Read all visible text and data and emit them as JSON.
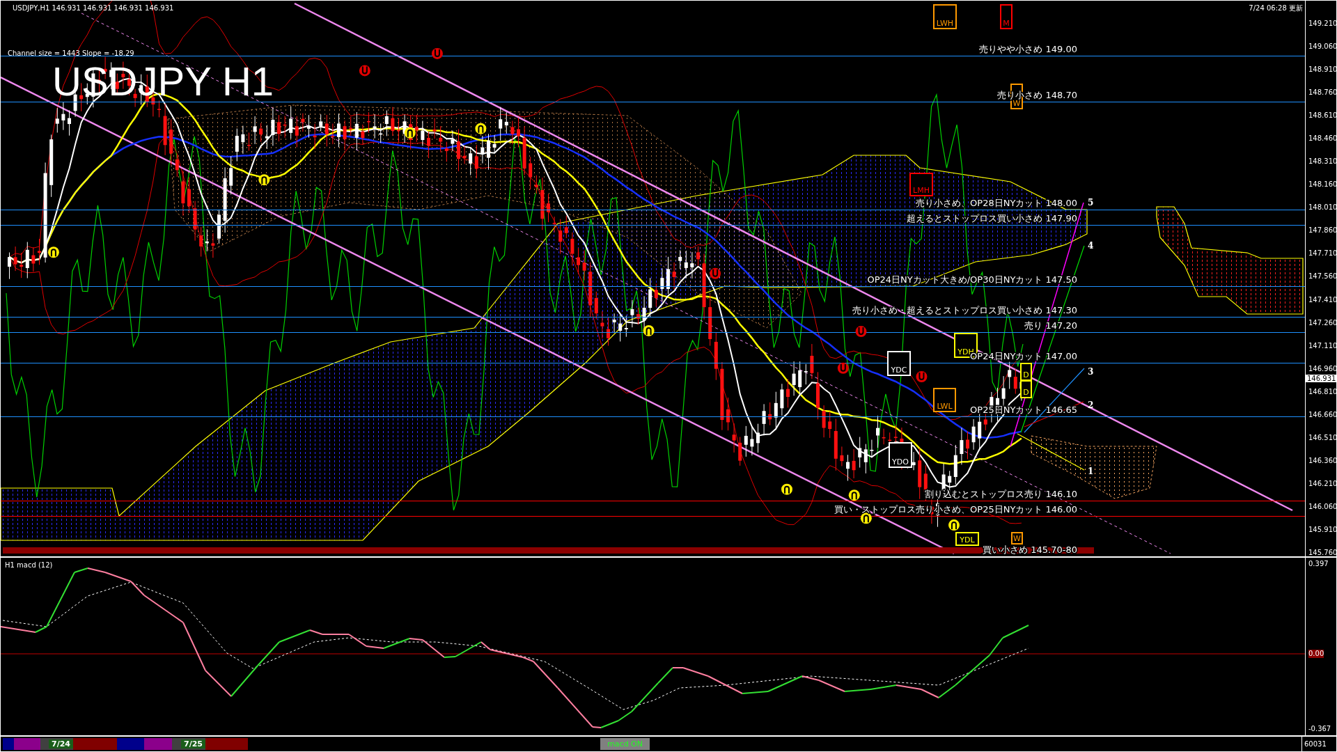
{
  "chart": {
    "header": "USDJPY,H1  146.931 146.931 146.931 146.931",
    "channel_info": "Channel size = 1443 Slope = -18.29",
    "title": "USDJPY H1",
    "updated": "7/24 06:28 更新",
    "levels": [
      {
        "label": "売りやや小さめ 149.00",
        "color": "#1e90ff"
      },
      {
        "label": "売り小さめ 148.70",
        "color": "#1e90ff"
      },
      {
        "label": "売り小さめ、OP28日NYカット 148.00",
        "color": "#1e90ff"
      },
      {
        "label": "超えるとストップロス買い小さめ 147.90",
        "color": "#1e90ff"
      },
      {
        "label": "OP24日NYカット大きめ/OP30日NYカット 147.50",
        "color": "#1e90ff"
      },
      {
        "label": "売り小さめ・超えるとストップロス買い小さめ 147.30",
        "color": "#1e90ff"
      },
      {
        "label": "売り 147.20",
        "color": "#1e90ff"
      },
      {
        "label": "OP24日NYカット 147.00",
        "color": "#1e90ff"
      },
      {
        "label": "OP25日NYカット 146.65",
        "color": "#1e90ff"
      },
      {
        "label": "割り込むとストップロス売り 146.10",
        "color": "#ff0000"
      },
      {
        "label": "買い・ストップロス売り小さめ、OP25日NYカット 146.00",
        "color": "#ff0000"
      }
    ],
    "band_label": "買い小さめ 145.70-80",
    "markers": [
      {
        "text": "LWH",
        "color": "#ff9900"
      },
      {
        "text": "M",
        "color": "#ff0000"
      },
      {
        "text": "W",
        "color": "#ff9900"
      },
      {
        "text": "LMH",
        "color": "#ff0000"
      },
      {
        "text": "YDH",
        "color": "#ffff00"
      },
      {
        "text": "YDC",
        "color": "#ffffff"
      },
      {
        "text": "D",
        "color": "#ffff00"
      },
      {
        "text": "D",
        "color": "#ffff00"
      },
      {
        "text": "YDO",
        "color": "#ffffff"
      },
      {
        "text": "LWL",
        "color": "#ff9900"
      },
      {
        "text": "YDL",
        "color": "#ffff00"
      },
      {
        "text": "W",
        "color": "#ff9900"
      }
    ],
    "wave_labels": [
      "5",
      "4",
      "3",
      "2",
      "1"
    ],
    "price_axis": {
      "ticks": [
        "149.210",
        "149.060",
        "148.910",
        "148.760",
        "148.610",
        "148.460",
        "148.310",
        "148.160",
        "148.010",
        "147.860",
        "147.710",
        "147.560",
        "147.410",
        "147.260",
        "147.110",
        "146.960",
        "146.810",
        "146.660",
        "146.510",
        "146.360",
        "146.210",
        "146.060",
        "145.910",
        "145.760"
      ],
      "current": "146.931"
    }
  },
  "macd": {
    "title": "H1  macd (12)",
    "ticks": [
      "0.397",
      "0.00",
      "-0.367"
    ]
  },
  "timeline": {
    "segments": [
      {
        "color": "#00008b"
      },
      {
        "color": "#8b008b"
      },
      {
        "label": "7/24",
        "color": "#404040"
      },
      {
        "color": "#800000"
      },
      {
        "color": "#00008b"
      },
      {
        "color": "#8b008b"
      },
      {
        "label": "7/25",
        "color": "#404040"
      },
      {
        "color": "#800000"
      }
    ],
    "macd_button": "macd ON",
    "counter": "60031"
  }
}
